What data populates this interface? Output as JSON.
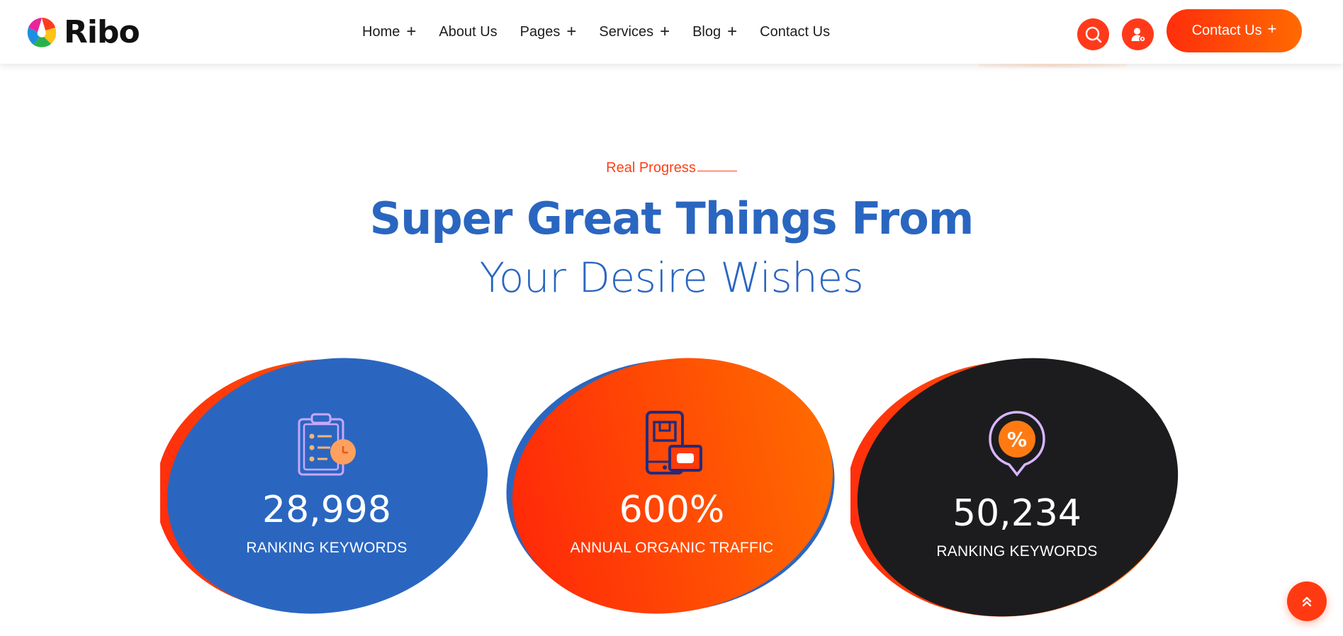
{
  "brand": {
    "name": "Ribo",
    "logo_icon": "ribo-logo-icon"
  },
  "nav": {
    "items": [
      {
        "label": "Home",
        "has_submenu": true
      },
      {
        "label": "About Us",
        "has_submenu": false
      },
      {
        "label": "Pages",
        "has_submenu": true
      },
      {
        "label": "Services",
        "has_submenu": true
      },
      {
        "label": "Blog",
        "has_submenu": true
      },
      {
        "label": "Contact Us",
        "has_submenu": false
      }
    ],
    "plus_symbol": "+"
  },
  "header_actions": {
    "search_icon": "search-icon",
    "user_icon": "user-settings-icon",
    "cta_label": "Contact Us",
    "cta_plus": "+"
  },
  "section": {
    "eyebrow": "Real Progress",
    "title_line1": "Super Great Things From",
    "title_line2": "Your Desire Wishes"
  },
  "stats": [
    {
      "value": "28,998",
      "label": "RANKING KEYWORDS",
      "icon": "clipboard-clock-icon",
      "main_color": "#2a66c0",
      "back_colors": [
        "#ff2e0c",
        "#ff6a00"
      ]
    },
    {
      "value": "600%",
      "label": "ANNUAL ORGANIC TRAFFIC",
      "icon": "mobile-shop-icon",
      "main_color": "#ff3a0a",
      "back_colors": [
        "#2a66c0"
      ]
    },
    {
      "value": "50,234",
      "label": "RANKING KEYWORDS",
      "icon": "percent-badge-icon",
      "main_color": "#1c1c1e",
      "back_colors": [
        "#ff2e0c",
        "#ff6a00"
      ]
    }
  ],
  "back_to_top": {
    "icon": "double-chevron-up-icon"
  },
  "colors": {
    "accent": "#ff3a12",
    "primary_blue": "#2a66c0",
    "dark": "#1c1c1e"
  }
}
